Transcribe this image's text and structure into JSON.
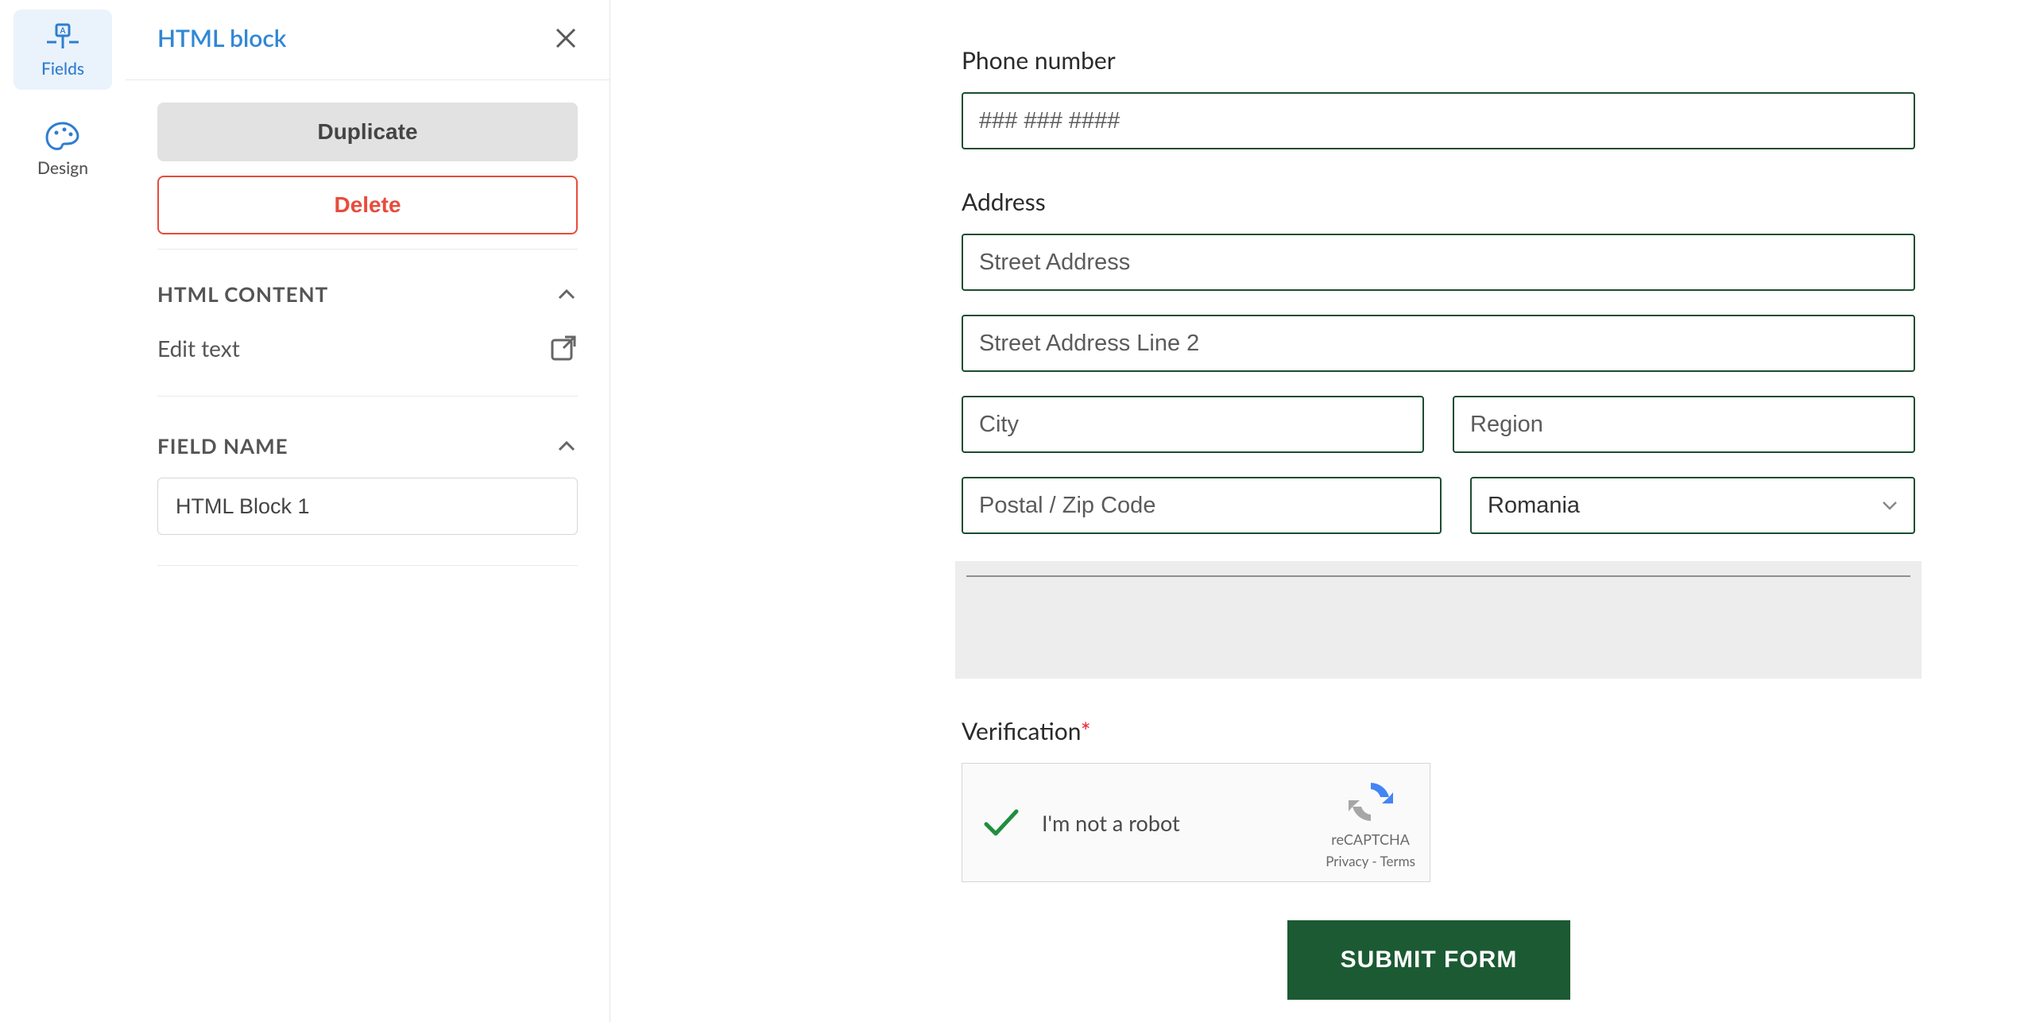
{
  "rail": {
    "fields_label": "Fields",
    "design_label": "Design"
  },
  "panel": {
    "title": "HTML block",
    "duplicate": "Duplicate",
    "delete": "Delete",
    "section_html": "HTML CONTENT",
    "edit_text": "Edit text",
    "section_fieldname": "FIELD NAME",
    "field_name_value": "HTML Block 1"
  },
  "form": {
    "phone_label": "Phone number",
    "phone_placeholder": "### ### ####",
    "address_label": "Address",
    "street1_placeholder": "Street Address",
    "street2_placeholder": "Street Address Line 2",
    "city_placeholder": "City",
    "region_placeholder": "Region",
    "postal_placeholder": "Postal / Zip Code",
    "country_value": "Romania",
    "verification_label": "Verification",
    "captcha_text": "I'm not a robot",
    "captcha_brand": "reCAPTCHA",
    "captcha_links": "Privacy - Terms",
    "submit": "SUBMIT FORM"
  },
  "colors": {
    "accent_form": "#1b4d2f",
    "accent_ui": "#3087d6",
    "danger": "#e74c3c"
  }
}
